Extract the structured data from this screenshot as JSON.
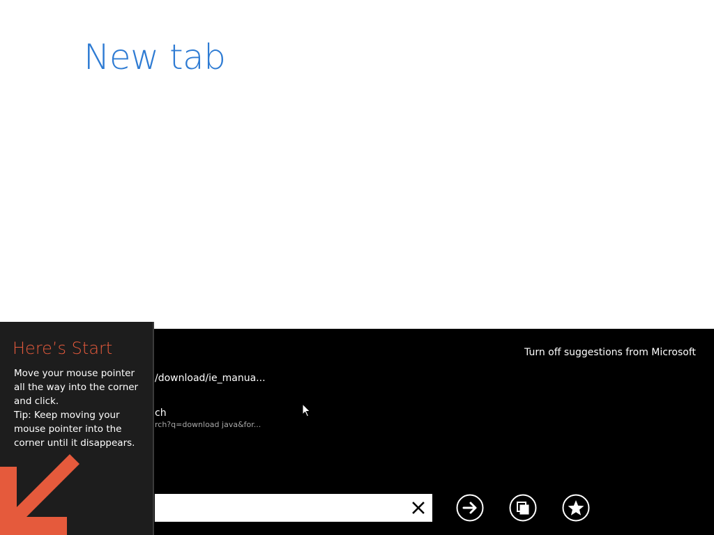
{
  "page": {
    "title": "New tab"
  },
  "app_bar": {
    "suggestions_toggle": "Turn off suggestions from Microsoft",
    "suggestions": [
      {
        "main": "/download/ie_manua..."
      },
      {
        "main": "ch",
        "sub": "rch?q=download java&for..."
      }
    ],
    "address": {
      "value": "",
      "placeholder": ""
    },
    "buttons": {
      "go": "go-arrow",
      "tabs": "tabs",
      "favorites": "star"
    }
  },
  "start_tip": {
    "title": "Here’s Start",
    "line1": "Move your mouse pointer all the way into the corner and click.",
    "line2": "Tip: Keep moving your mouse pointer into the corner until it disappears."
  },
  "colors": {
    "title_blue": "#2e7bd3",
    "tip_orange": "#e55a3c",
    "bar_black": "#000000",
    "tip_bg": "#1d1d1d"
  }
}
